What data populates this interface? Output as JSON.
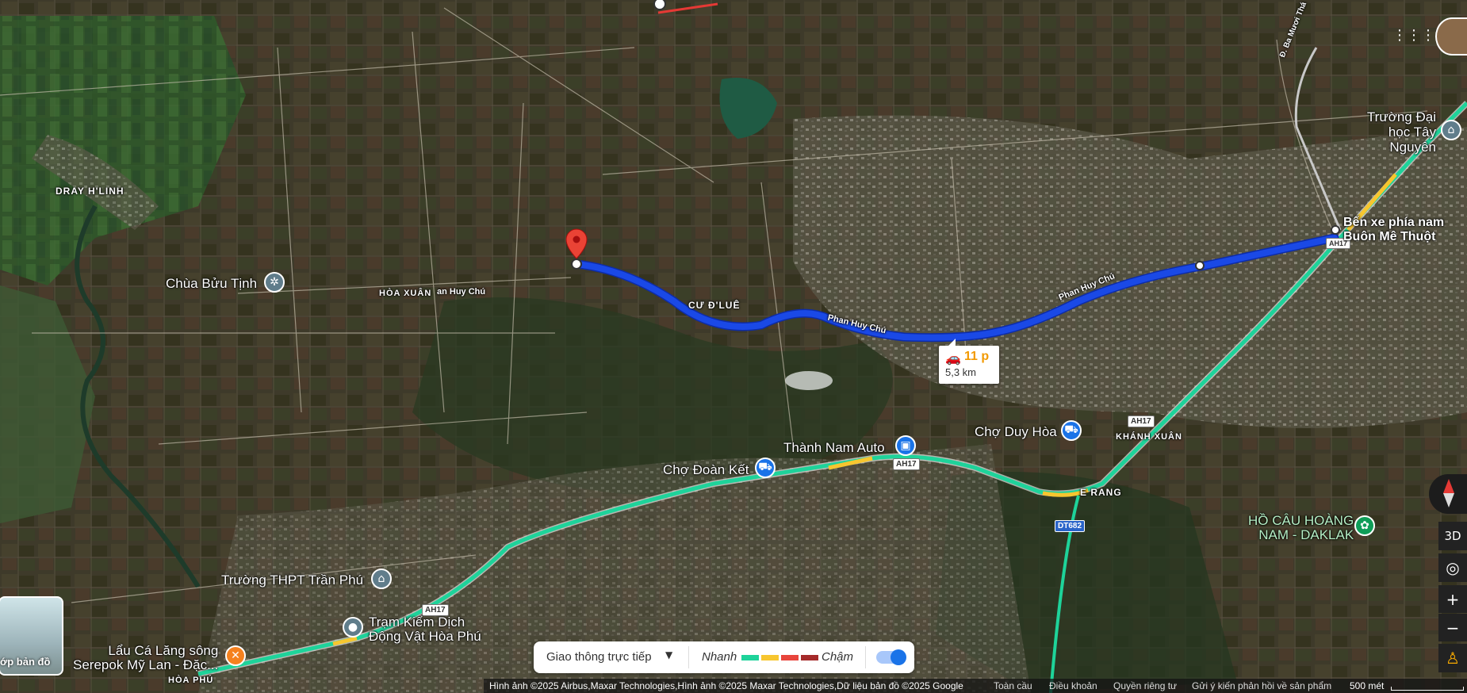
{
  "route": {
    "eta": "11 p",
    "distance": "5,3 km"
  },
  "labels": {
    "area_dray_hlinh": "DRAY H'LINH",
    "area_hoa_xuan": "HÒA XUÂN",
    "area_cu_dlue": "CƯ Đ'LUÊ",
    "area_khanh_xuan": "KHÁNH XUÂN",
    "area_e_rang": "E RANG",
    "area_hoa_phu": "HÒA PHÚ",
    "road_phan_huy_chu_1": "Phan Huy Chú",
    "road_phan_huy_chu_2": "Phan Huy Chú",
    "road_phan_huy_chu_3": "an Huy Chú",
    "road_ba_muoi_thang": "Đ. Ba Mươi Thá",
    "shield_ah17_1": "AH17",
    "shield_ah17_2": "AH17",
    "shield_ah17_3": "AH17",
    "shield_ah17_4": "AH17",
    "shield_dt682": "DT682"
  },
  "pois": {
    "chua_buu_tinh": "Chùa Bửu Tịnh",
    "truong_dai_hoc": "Trường Đại\nhọc Tây\nNguyên",
    "ben_xe": "Bến xe phía nam\nBuôn Mê Thuột",
    "cho_duy_hoa": "Chợ Duy Hòa",
    "thanh_nam_auto": "Thành Nam Auto",
    "cho_doan_ket": "Chợ Đoàn Kết",
    "ho_cau": "HỒ CÂU HOÀNG\nNAM - DAKLAK",
    "truong_thpt": "Trường THPT Trần Phú",
    "tram_kiem_dich": "Trạm Kiểm Dịch\nĐộng Vật Hòa Phú",
    "lau_ca": "Lẩu Cá Lăng sông\nSerepok Mỹ Lan - Đặc..."
  },
  "traffic": {
    "label": "Giao thông trực tiếp",
    "fast": "Nhanh",
    "slow": "Chậm",
    "colors": [
      "#1ed39a",
      "#f7c62f",
      "#e8453c",
      "#a52a2a"
    ],
    "enabled": true
  },
  "controls": {
    "layers_label": "ớp bản đồ",
    "btn_3d": "3D"
  },
  "footer": {
    "attribution": "Hình ảnh ©2025 Airbus,Maxar Technologies,Hình ảnh ©2025 Maxar Technologies,Dữ liệu bản đồ ©2025 Google",
    "links": [
      "Toàn cầu",
      "Điều khoản",
      "Quyền riêng tư",
      "Gửi ý kiến phản hồi về sản phẩm"
    ],
    "scale": "500 mét"
  },
  "colors": {
    "route": "#1a49e6",
    "highway_traffic": "#1ed39a",
    "pin": "#ea4335",
    "poi_blue": "#1a73e8",
    "poi_gray": "#607d8b",
    "poi_orange": "#f5811f",
    "poi_green": "#0f9d58"
  }
}
